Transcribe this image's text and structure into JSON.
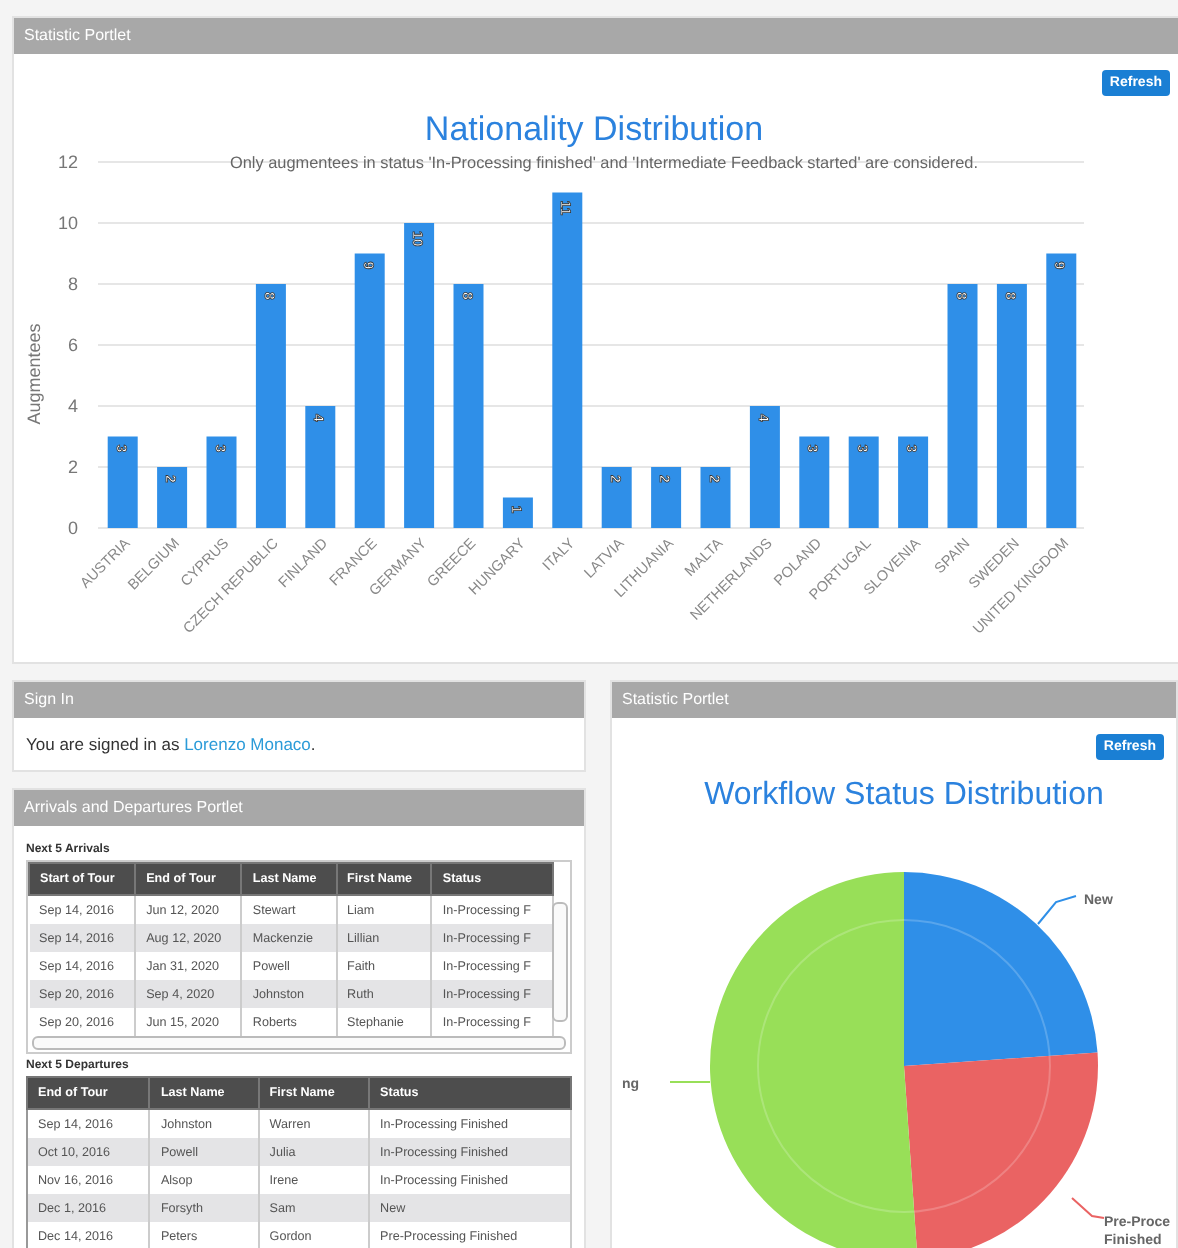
{
  "statistic_portlet": {
    "title": "Statistic Portlet",
    "refresh_button": "Refresh",
    "chart_data": {
      "type": "bar",
      "title": "Nationality Distribution",
      "subtitle": "Only augmentees in status 'In-Processing finished' and 'Intermediate Feedback started' are considered.",
      "ylabel": "Augmentees",
      "categories": [
        "AUSTRIA",
        "BELGIUM",
        "CYPRUS",
        "CZECH REPUBLIC",
        "FINLAND",
        "FRANCE",
        "GERMANY",
        "GREECE",
        "HUNGARY",
        "ITALY",
        "LATVIA",
        "LITHUANIA",
        "MALTA",
        "NETHERLANDS",
        "POLAND",
        "PORTUGAL",
        "SLOVENIA",
        "SPAIN",
        "SWEDEN",
        "UNITED KINGDOM"
      ],
      "series": [
        {
          "color": "#2f8fe8",
          "values": [
            3,
            2,
            3,
            8,
            4,
            9,
            10,
            8,
            1,
            11,
            2,
            2,
            2,
            4,
            3,
            3,
            3,
            8,
            8,
            9
          ]
        }
      ],
      "ylim": [
        0,
        12
      ],
      "yticks": [
        0,
        2,
        4,
        6,
        8,
        10,
        12
      ],
      "data_labels": true,
      "grid": true
    }
  },
  "sign_in": {
    "title": "Sign In",
    "text": "You are signed in as ",
    "user_link": "Lorenzo Monaco",
    "after": "."
  },
  "arrivals_departures": {
    "title": "Arrivals and Departures Portlet",
    "arrivals": {
      "heading": "Next 5 Arrivals",
      "columns": [
        "Start of Tour",
        "End of Tour",
        "Last Name",
        "First Name",
        "Status"
      ],
      "rows": [
        [
          "Sep 14, 2016",
          "Jun 12, 2020",
          "Stewart",
          "Liam",
          "In-Processing F"
        ],
        [
          "Sep 14, 2016",
          "Aug 12, 2020",
          "Mackenzie",
          "Lillian",
          "In-Processing F"
        ],
        [
          "Sep 14, 2016",
          "Jan 31, 2020",
          "Powell",
          "Faith",
          "In-Processing F"
        ],
        [
          "Sep 20, 2016",
          "Sep 4, 2020",
          "Johnston",
          "Ruth",
          "In-Processing F"
        ],
        [
          "Sep 20, 2016",
          "Jun 15, 2020",
          "Roberts",
          "Stephanie",
          "In-Processing F"
        ]
      ]
    },
    "departures": {
      "heading": "Next 5 Departures",
      "columns": [
        "End of Tour",
        "Last Name",
        "First Name",
        "Status"
      ],
      "rows": [
        [
          "Sep 14, 2016",
          "Johnston",
          "Warren",
          "In-Processing Finished"
        ],
        [
          "Oct 10, 2016",
          "Powell",
          "Julia",
          "In-Processing Finished"
        ],
        [
          "Nov 16, 2016",
          "Alsop",
          "Irene",
          "In-Processing Finished"
        ],
        [
          "Dec 1, 2016",
          "Forsyth",
          "Sam",
          "New"
        ],
        [
          "Dec 14, 2016",
          "Peters",
          "Gordon",
          "Pre-Processing Finished"
        ]
      ]
    }
  },
  "workflow_portlet": {
    "title": "Statistic Portlet",
    "refresh_button": "Refresh",
    "chart_title": "Workflow Status Distribution",
    "pie_labels": [
      "New",
      "ng",
      "Pre-Proce",
      "Finished"
    ]
  }
}
